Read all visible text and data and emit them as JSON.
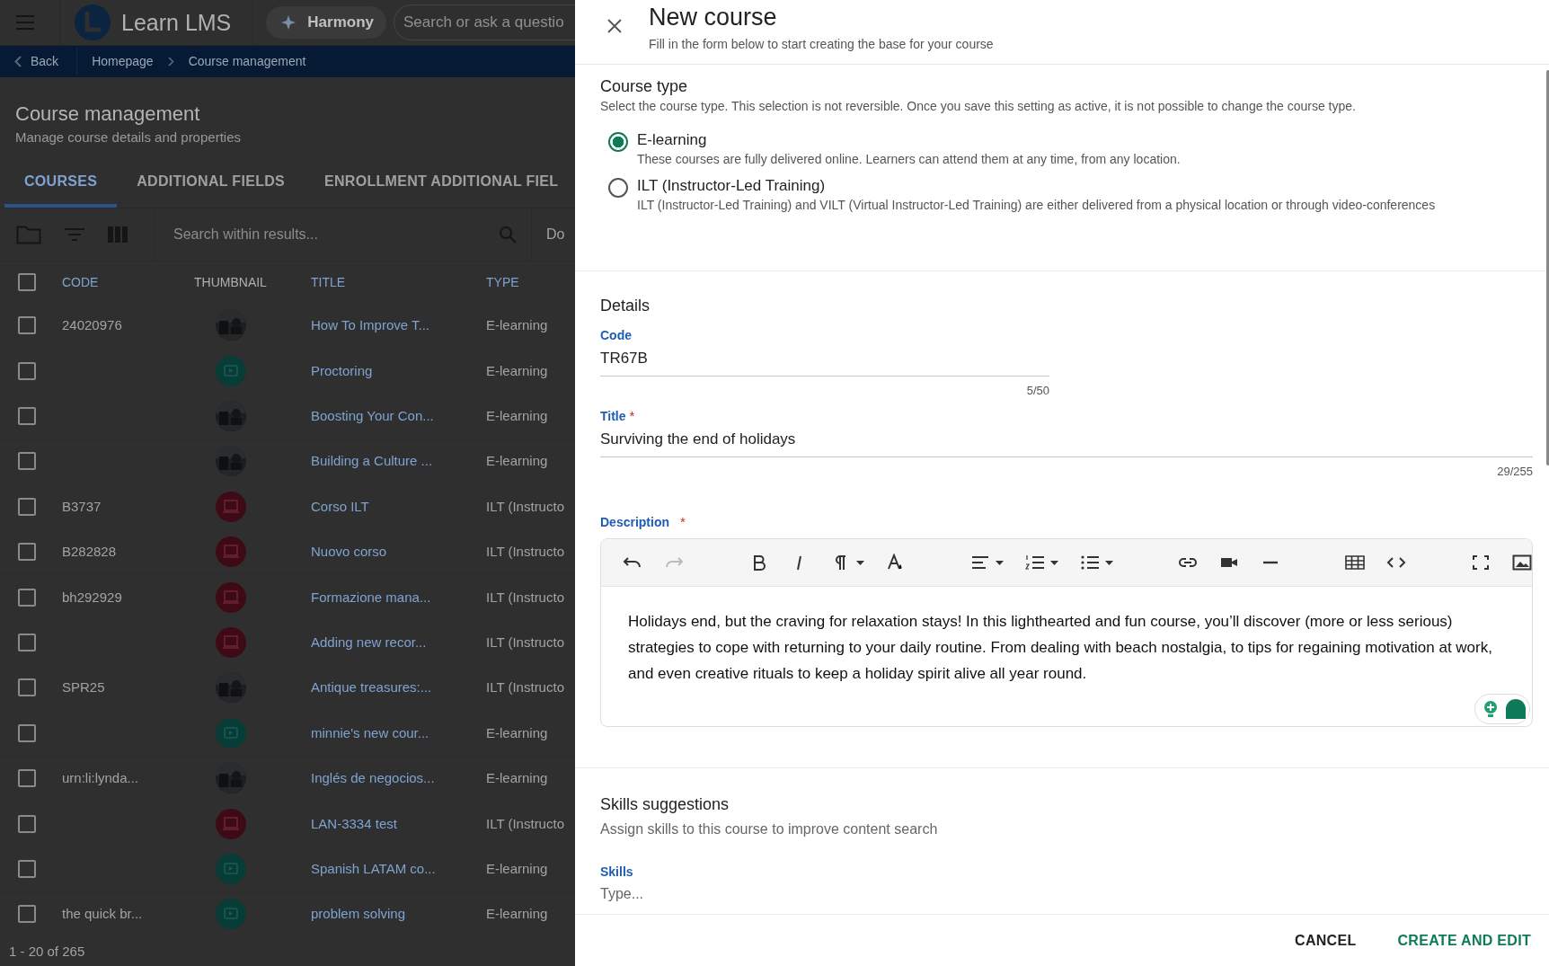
{
  "app_bar": {
    "logo_text": "Learn LMS",
    "assistant_label": "Harmony",
    "search_placeholder": "Search or ask a questio"
  },
  "breadcrumb": {
    "back": "Back",
    "items": [
      "Homepage",
      "Course management"
    ]
  },
  "page": {
    "title": "Course management",
    "subtitle": "Manage course details and properties"
  },
  "tabs": [
    {
      "label": "COURSES",
      "selected": true
    },
    {
      "label": "ADDITIONAL FIELDS",
      "selected": false
    },
    {
      "label": "ENROLLMENT ADDITIONAL FIEL",
      "selected": false
    }
  ],
  "toolbar": {
    "search_placeholder": "Search within results...",
    "column_5": "Do"
  },
  "table": {
    "header_checked": false,
    "columns": [
      {
        "label": "CODE",
        "sortable": true
      },
      {
        "label": "THUMBNAIL",
        "sortable": false
      },
      {
        "label": "TITLE",
        "sortable": true
      },
      {
        "label": "TYPE",
        "sortable": true
      }
    ],
    "rows": [
      {
        "checked": false,
        "code": "24020976",
        "kind": "picture",
        "title": "How To Improve T...",
        "type": "E-learning"
      },
      {
        "checked": false,
        "kind": "video",
        "title": "Proctoring",
        "type": "E-learning"
      },
      {
        "checked": false,
        "kind": "picture",
        "title": "Boosting Your Con...",
        "type": "E-learning"
      },
      {
        "checked": false,
        "kind": "picture",
        "title": "Building a Culture ...",
        "type": "E-learning"
      },
      {
        "checked": false,
        "code": "B3737",
        "kind": "classroom",
        "title": "Corso ILT",
        "type": "ILT (Instructo"
      },
      {
        "checked": false,
        "code": "B282828",
        "kind": "classroom",
        "title": "Nuovo corso",
        "type": "ILT (Instructo"
      },
      {
        "checked": false,
        "code": "bh292929",
        "kind": "classroom",
        "title": "Formazione mana...",
        "type": "ILT (Instructo"
      },
      {
        "checked": false,
        "kind": "classroom",
        "title": "Adding new recor...",
        "type": "ILT (Instructo"
      },
      {
        "checked": false,
        "code": "SPR25",
        "kind": "picture",
        "title": "Antique treasures:...",
        "type": "ILT (Instructo"
      },
      {
        "checked": false,
        "kind": "video",
        "title": "minnie's new cour...",
        "type": "E-learning"
      },
      {
        "checked": false,
        "code": "urn:li:lynda...",
        "kind": "picture",
        "title": "Inglés de negocios...",
        "type": "E-learning"
      },
      {
        "checked": false,
        "kind": "classroom",
        "title": "LAN-3334 test",
        "type": "ILT (Instructo"
      },
      {
        "checked": false,
        "kind": "video",
        "title": "Spanish LATAM co...",
        "type": "E-learning"
      },
      {
        "checked": false,
        "code": "the quick br...",
        "kind": "video",
        "title": "problem solving",
        "type": "E-learning"
      }
    ]
  },
  "pagination": "1 - 20 of 265",
  "dialog": {
    "title": "New course",
    "subtitle": "Fill in the form below to start creating the base for your course",
    "course_type": {
      "heading": "Course type",
      "description": "Select the course type. This selection is not reversible. Once you save this setting as active, it is not possible to change the course type.",
      "options": [
        {
          "label": "E-learning",
          "description": "These courses are fully delivered online. Learners can attend them at any time, from any location.",
          "selected": true
        },
        {
          "label": "ILT (Instructor-Led Training)",
          "description": "ILT (Instructor-Led Training) and VILT (Virtual Instructor-Led Training) are either delivered from a physical location or through video-conferences",
          "selected": false
        }
      ]
    },
    "details": {
      "heading": "Details",
      "fields": [
        {
          "label": "Code",
          "value": "TR67B",
          "counter": "5/50",
          "kind": "short"
        },
        {
          "label": "Title",
          "required_mark": "*",
          "value": "Surviving the end of holidays",
          "counter": "29/255",
          "kind": "long"
        }
      ]
    },
    "description": {
      "label": "Description",
      "required_mark": "*",
      "text": "Holidays end, but the craving for relaxation stays! In this lighthearted and fun course, you’ll discover (more or less serious) strategies to cope with returning to your daily routine. From dealing with beach nostalgia, to tips for regaining motivation at work, and even creative rituals to keep a holiday spirit alive all year round."
    },
    "skills": {
      "heading": "Skills suggestions",
      "description": "Assign skills to this course to improve content search",
      "label": "Skills",
      "placeholder": "Type..."
    },
    "buttons": [
      {
        "label": "CANCEL",
        "kind": "secondary"
      },
      {
        "label": "CREATE AND EDIT",
        "kind": "primary"
      }
    ]
  }
}
